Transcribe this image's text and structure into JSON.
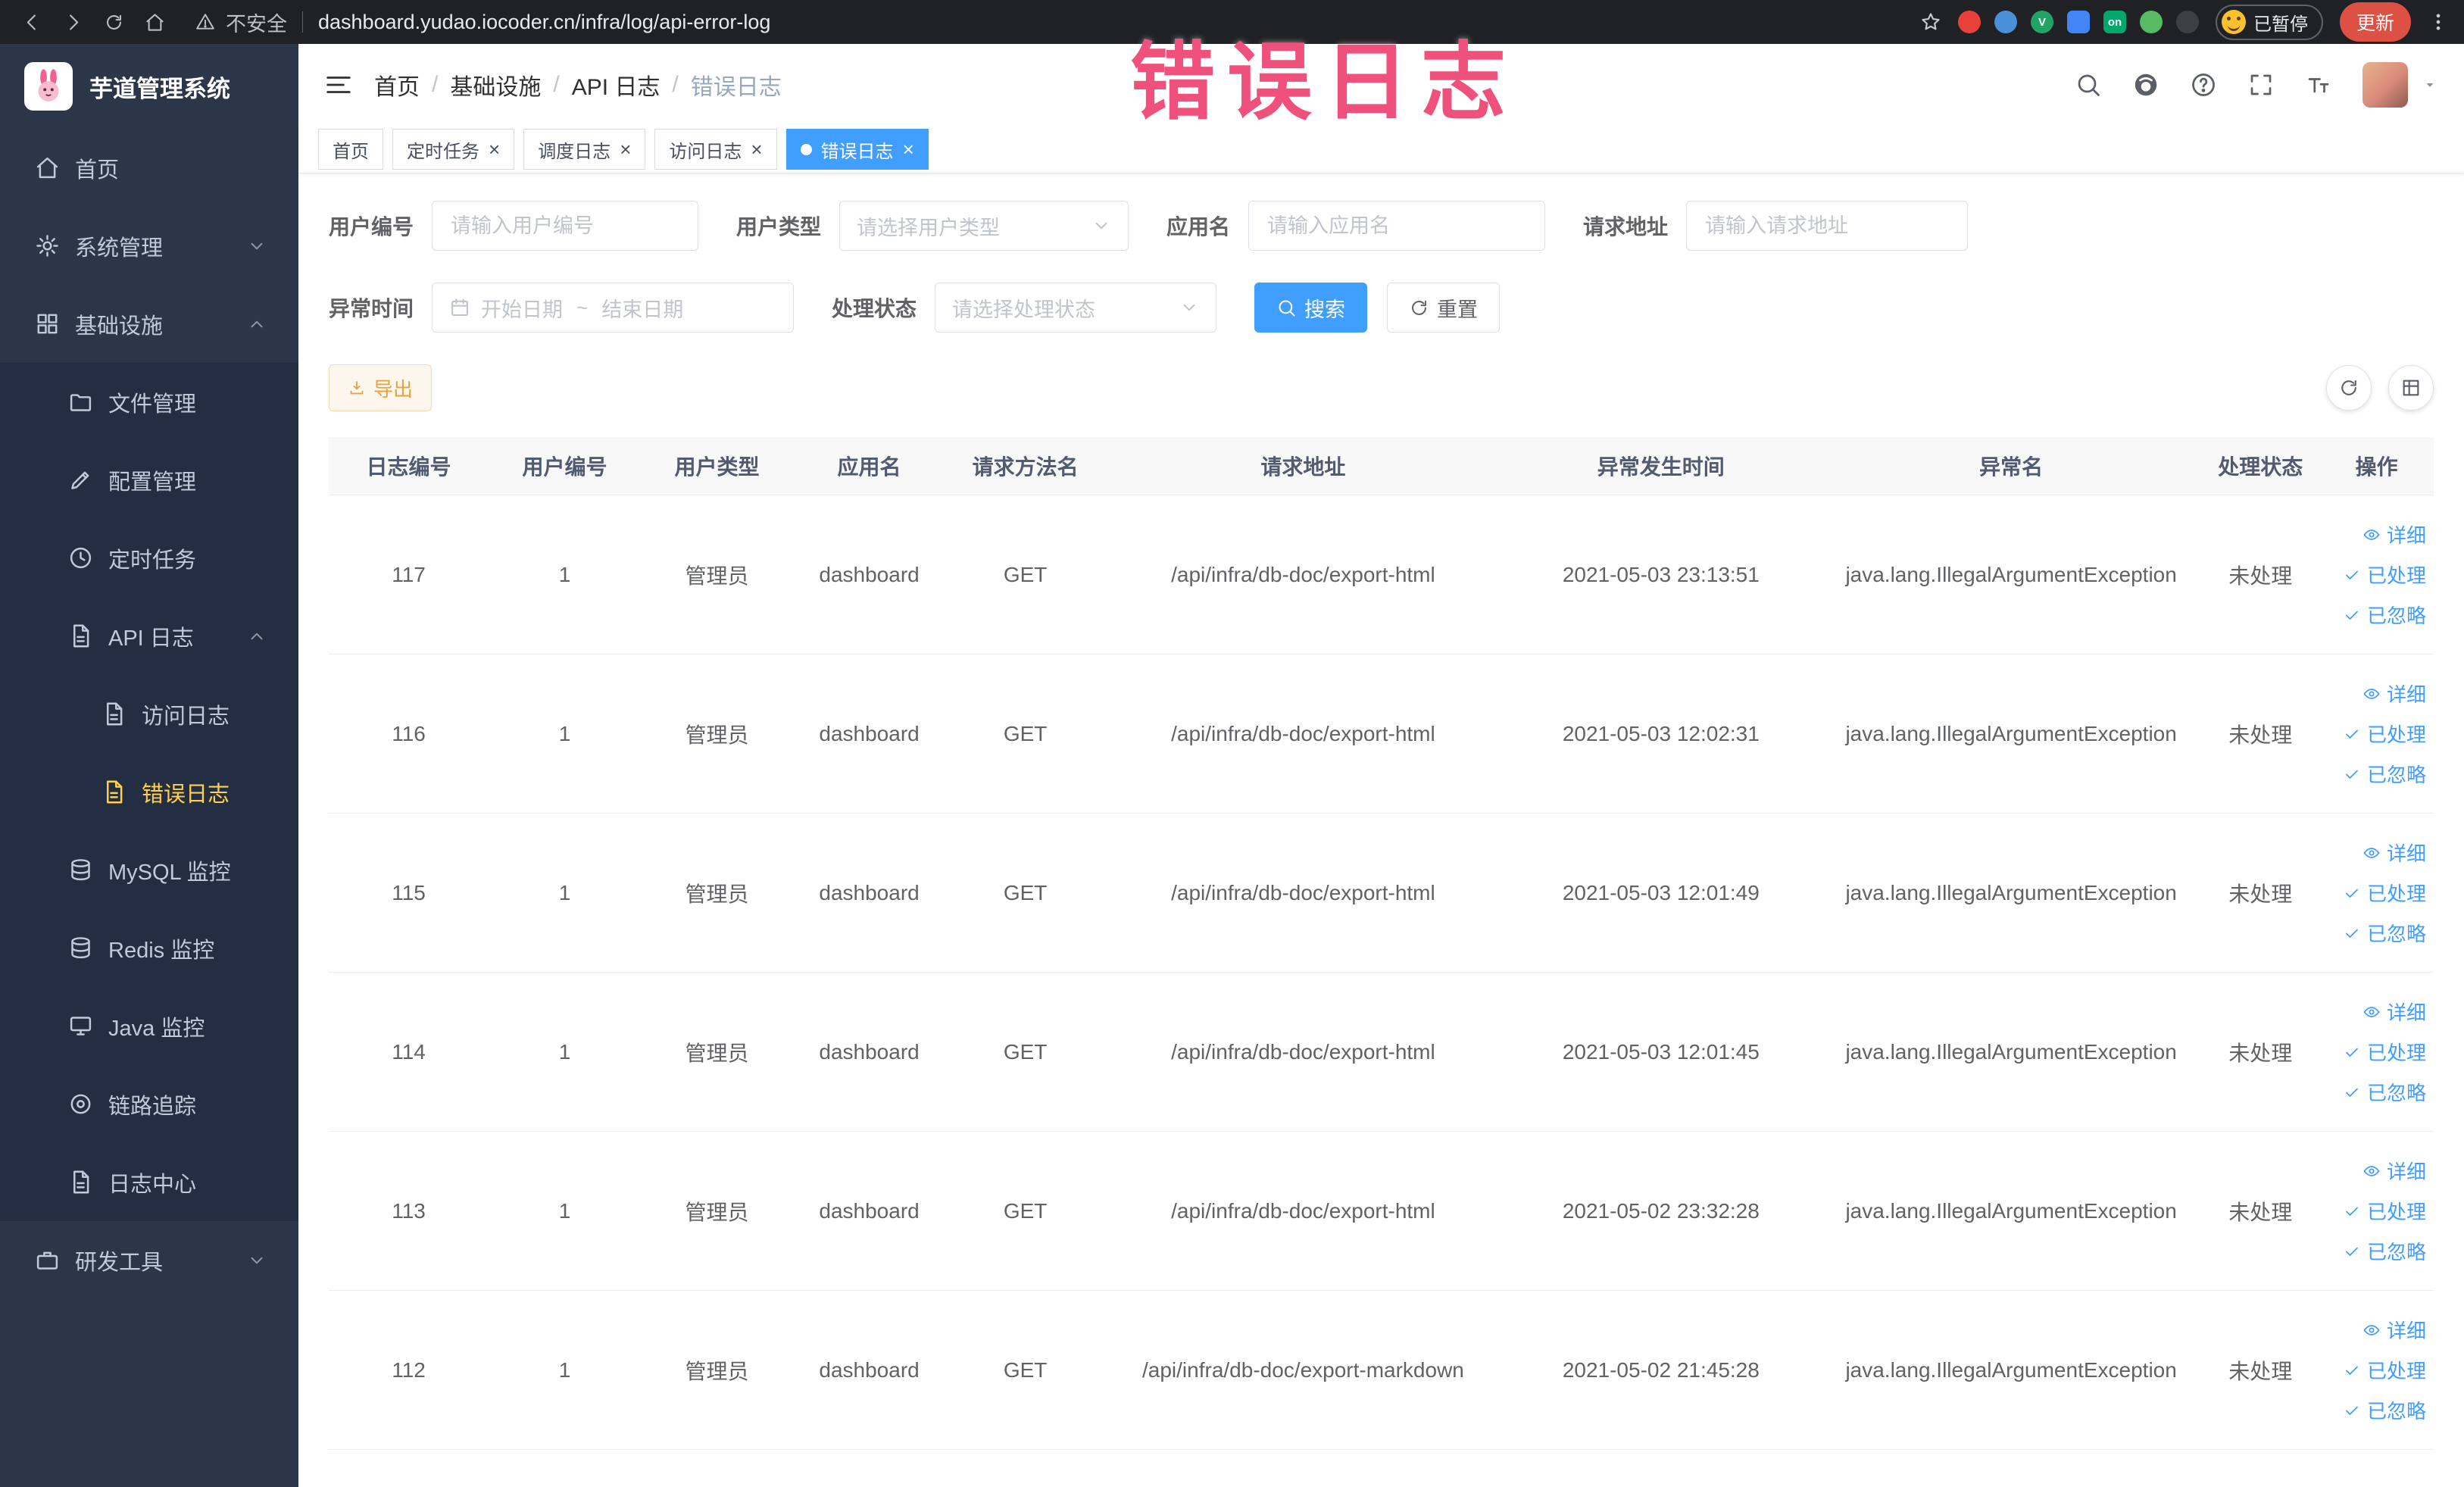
{
  "colors": {
    "accent": "#409eff",
    "chrome-bg": "#202124",
    "sidebar-bg": "#2b3648",
    "submenu-bg": "#232e42",
    "sidebar-text": "#bfcbd9",
    "active-yellow": "#ffd04b",
    "warning-text": "#e6a23c",
    "warning-bg": "#fdf6ec",
    "warning-border": "#f5dab1",
    "border": "#dcdfe6",
    "table-border": "#ebeef5",
    "annotation": "#f0517c",
    "update-red": "#dd5144"
  },
  "annotation": {
    "text": "错误日志"
  },
  "browser": {
    "security_label": "不安全",
    "url": "dashboard.yudao.iocoder.cn/infra/log/api-error-log",
    "paused_badge": "已暂停",
    "update_button": "更新",
    "extensions": [
      {
        "name": "red-dot-extension-icon",
        "color": "#e8413c",
        "shape": "circle"
      },
      {
        "name": "blue-drop-extension-icon",
        "color": "#4a90d9",
        "shape": "circle"
      },
      {
        "name": "green-v-extension-icon",
        "color": "#21a366",
        "shape": "circle",
        "label": "V"
      },
      {
        "name": "blue-grid-extension-icon",
        "color": "#4285f4",
        "shape": "square"
      },
      {
        "name": "on-badge-extension-icon",
        "color": "#00a86b",
        "shape": "square",
        "label": "on"
      },
      {
        "name": "leaf-extension-icon",
        "color": "#57bb63",
        "shape": "circle"
      },
      {
        "name": "paw-extension-icon",
        "color": "#3c4043",
        "shape": "circle"
      }
    ]
  },
  "sidebar": {
    "logo_title": "芋道管理系统",
    "items": [
      {
        "label": "首页",
        "icon": "home-icon",
        "level": 0
      },
      {
        "label": "系统管理",
        "icon": "gear-icon",
        "level": 0,
        "expand": "down"
      },
      {
        "label": "基础设施",
        "icon": "infra-icon",
        "level": 0,
        "expand": "up"
      },
      {
        "label": "文件管理",
        "icon": "file-icon",
        "level": 1
      },
      {
        "label": "配置管理",
        "icon": "config-icon",
        "level": 1
      },
      {
        "label": "定时任务",
        "icon": "job-icon",
        "level": 1
      },
      {
        "label": "API 日志",
        "icon": "api-log-icon",
        "level": 1,
        "expand": "up"
      },
      {
        "label": "访问日志",
        "icon": "access-log-icon",
        "level": 2
      },
      {
        "label": "错误日志",
        "icon": "error-log-icon",
        "level": 2,
        "active": true
      },
      {
        "label": "MySQL 监控",
        "icon": "mysql-icon",
        "level": 1
      },
      {
        "label": "Redis 监控",
        "icon": "redis-icon",
        "level": 1
      },
      {
        "label": "Java 监控",
        "icon": "java-icon",
        "level": 1
      },
      {
        "label": "链路追踪",
        "icon": "trace-icon",
        "level": 1
      },
      {
        "label": "日志中心",
        "icon": "log-center-icon",
        "level": 1
      },
      {
        "label": "研发工具",
        "icon": "tools-icon",
        "level": 0,
        "expand": "down"
      }
    ]
  },
  "header": {
    "breadcrumb": [
      "首页",
      "基础设施",
      "API 日志",
      "错误日志"
    ],
    "separator": "/"
  },
  "tabs": [
    {
      "label": "首页",
      "closable": false,
      "active": false
    },
    {
      "label": "定时任务",
      "closable": true,
      "active": false
    },
    {
      "label": "调度日志",
      "closable": true,
      "active": false
    },
    {
      "label": "访问日志",
      "closable": true,
      "active": false
    },
    {
      "label": "错误日志",
      "closable": true,
      "active": true
    }
  ],
  "filters": {
    "user_id": {
      "label": "用户编号",
      "placeholder": "请输入用户编号",
      "value": ""
    },
    "user_type": {
      "label": "用户类型",
      "placeholder": "请选择用户类型"
    },
    "app_name": {
      "label": "应用名",
      "placeholder": "请输入应用名",
      "value": ""
    },
    "request_url": {
      "label": "请求地址",
      "placeholder": "请输入请求地址",
      "value": ""
    },
    "exception_time": {
      "label": "异常时间",
      "start_placeholder": "开始日期",
      "separator": "~",
      "end_placeholder": "结束日期"
    },
    "process_status": {
      "label": "处理状态",
      "placeholder": "请选择处理状态"
    },
    "search_button": "搜索",
    "reset_button": "重置"
  },
  "toolbar": {
    "export_button": "导出"
  },
  "table": {
    "columns": [
      "日志编号",
      "用户编号",
      "用户类型",
      "应用名",
      "请求方法名",
      "请求地址",
      "异常发生时间",
      "异常名",
      "处理状态",
      "操作"
    ],
    "action_labels": [
      "详细",
      "已处理",
      "已忽略"
    ],
    "rows": [
      {
        "log_id": "117",
        "user_id": "1",
        "user_type": "管理员",
        "app_name": "dashboard",
        "method": "GET",
        "url": "/api/infra/db-doc/export-html",
        "time": "2021-05-03 23:13:51",
        "exception": "java.lang.IllegalArgumentException",
        "status": "未处理"
      },
      {
        "log_id": "116",
        "user_id": "1",
        "user_type": "管理员",
        "app_name": "dashboard",
        "method": "GET",
        "url": "/api/infra/db-doc/export-html",
        "time": "2021-05-03 12:02:31",
        "exception": "java.lang.IllegalArgumentException",
        "status": "未处理"
      },
      {
        "log_id": "115",
        "user_id": "1",
        "user_type": "管理员",
        "app_name": "dashboard",
        "method": "GET",
        "url": "/api/infra/db-doc/export-html",
        "time": "2021-05-03 12:01:49",
        "exception": "java.lang.IllegalArgumentException",
        "status": "未处理"
      },
      {
        "log_id": "114",
        "user_id": "1",
        "user_type": "管理员",
        "app_name": "dashboard",
        "method": "GET",
        "url": "/api/infra/db-doc/export-html",
        "time": "2021-05-03 12:01:45",
        "exception": "java.lang.IllegalArgumentException",
        "status": "未处理"
      },
      {
        "log_id": "113",
        "user_id": "1",
        "user_type": "管理员",
        "app_name": "dashboard",
        "method": "GET",
        "url": "/api/infra/db-doc/export-html",
        "time": "2021-05-02 23:32:28",
        "exception": "java.lang.IllegalArgumentException",
        "status": "未处理"
      },
      {
        "log_id": "112",
        "user_id": "1",
        "user_type": "管理员",
        "app_name": "dashboard",
        "method": "GET",
        "url": "/api/infra/db-doc/export-markdown",
        "time": "2021-05-02 21:45:28",
        "exception": "java.lang.IllegalArgumentException",
        "status": "未处理"
      }
    ]
  }
}
